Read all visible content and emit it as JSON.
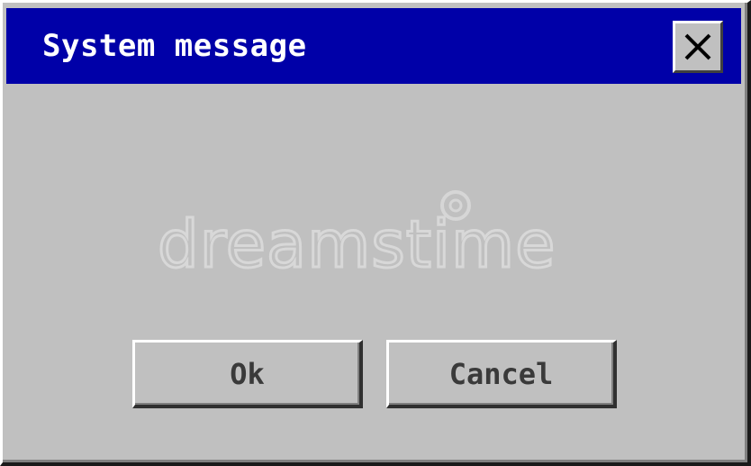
{
  "window": {
    "title": "System message",
    "close_icon": "close-icon"
  },
  "buttons": {
    "ok_label": "Ok",
    "cancel_label": "Cancel"
  },
  "watermark": {
    "text": "dreamstime"
  },
  "colors": {
    "titlebar": "#0000a8",
    "window_face": "#c0c0c0",
    "title_text": "#ffffff",
    "button_text": "#3a3a3a"
  }
}
